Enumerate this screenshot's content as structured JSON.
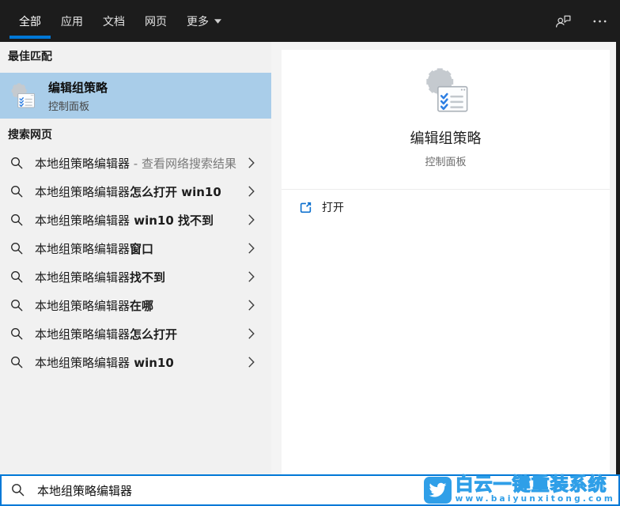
{
  "colors": {
    "accent": "#0078d7",
    "topbar-bg": "#1c1c1c",
    "left-bg": "#f1f1f1",
    "right-backdrop": "#f4f4f4",
    "highlight": "#a9cde9",
    "watermark-blue": "#2f9fe8"
  },
  "topbar": {
    "tabs": [
      {
        "label": "全部",
        "selected": true
      },
      {
        "label": "应用",
        "selected": false
      },
      {
        "label": "文档",
        "selected": false
      },
      {
        "label": "网页",
        "selected": false
      },
      {
        "label": "更多",
        "selected": false
      }
    ]
  },
  "left": {
    "best_match_header": "最佳匹配",
    "best_match": {
      "title": "编辑组策略",
      "subtitle": "控制面板"
    },
    "web_search_header": "搜索网页",
    "suggestions": [
      {
        "query": "本地组策略编辑器",
        "suffix": " - 查看网络搜索结果"
      },
      {
        "query": "本地组策略编辑器",
        "suffix": "怎么打开 win10"
      },
      {
        "query": "本地组策略编辑器",
        "suffix": " win10 找不到"
      },
      {
        "query": "本地组策略编辑器",
        "suffix": "窗口"
      },
      {
        "query": "本地组策略编辑器",
        "suffix": "找不到"
      },
      {
        "query": "本地组策略编辑器",
        "suffix": "在哪"
      },
      {
        "query": "本地组策略编辑器",
        "suffix": "怎么打开"
      },
      {
        "query": "本地组策略编辑器",
        "suffix": " win10"
      }
    ]
  },
  "preview": {
    "title": "编辑组策略",
    "subtitle": "控制面板",
    "open_label": "打开"
  },
  "search": {
    "value": "本地组策略编辑器"
  },
  "watermark": {
    "title": "白云一键重装系统",
    "url": "www.baiyunxitong.com"
  }
}
